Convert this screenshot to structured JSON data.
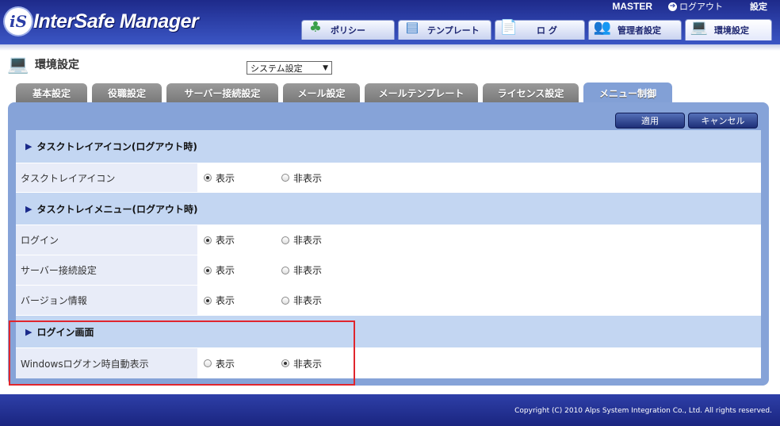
{
  "app": {
    "logo_mark": "iS",
    "logo_text": "InterSafe Manager"
  },
  "topbar": {
    "user": "MASTER",
    "logout_label": "ログアウト",
    "settings_label": "設定"
  },
  "nav_tabs": [
    {
      "label": "ポリシー",
      "icon": "clover-icon"
    },
    {
      "label": "テンプレート",
      "icon": "template-icon"
    },
    {
      "label": "ロ グ",
      "icon": "log-icon"
    },
    {
      "label": "管理者設定",
      "icon": "admin-icon"
    },
    {
      "label": "環境設定",
      "icon": "environment-icon",
      "active": true
    }
  ],
  "page": {
    "title": "環境設定",
    "select_value": "システム設定"
  },
  "settings_tabs": [
    {
      "label": "基本設定"
    },
    {
      "label": "役職設定"
    },
    {
      "label": "サーバー接続設定"
    },
    {
      "label": "メール設定"
    },
    {
      "label": "メールテンプレート"
    },
    {
      "label": "ライセンス設定"
    },
    {
      "label": "メニュー制御",
      "active": true
    }
  ],
  "buttons": {
    "apply": "適用",
    "cancel": "キャンセル"
  },
  "sections": [
    {
      "title": "タスクトレイアイコン(ログアウト時)",
      "rows": [
        {
          "label": "タスクトレイアイコン",
          "options": [
            "表示",
            "非表示"
          ],
          "selected": "表示"
        }
      ]
    },
    {
      "title": "タスクトレイメニュー(ログアウト時)",
      "rows": [
        {
          "label": "ログイン",
          "options": [
            "表示",
            "非表示"
          ],
          "selected": "表示"
        },
        {
          "label": "サーバー接続設定",
          "options": [
            "表示",
            "非表示"
          ],
          "selected": "表示"
        },
        {
          "label": "バージョン情報",
          "options": [
            "表示",
            "非表示"
          ],
          "selected": "表示"
        }
      ]
    },
    {
      "title": "ログイン画面",
      "rows": [
        {
          "label": "Windowsログオン時自動表示",
          "options": [
            "表示",
            "非表示"
          ],
          "selected": "非表示"
        }
      ]
    }
  ],
  "footer": {
    "copyright": "Copyright (C) 2010 Alps System Integration Co., Ltd. All rights reserved."
  },
  "colors": {
    "header": "#2b3ea6",
    "panel": "#86a3d8",
    "section": "#c3d6f2",
    "highlight": "#e0262d"
  }
}
